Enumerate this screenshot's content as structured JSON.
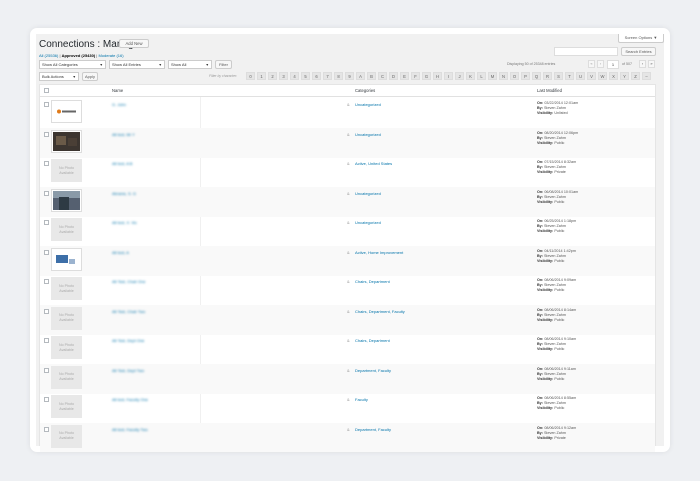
{
  "header": {
    "title": "Connections : Manage",
    "add_new": "Add New",
    "screen_options": "Screen Options ▼"
  },
  "subsubsub": {
    "all": "All (25536)",
    "sep1": " | ",
    "approved": "Approved (25430)",
    "sep2": " | ",
    "moderate": "Moderate (16)"
  },
  "search": {
    "button": "Search Entries"
  },
  "filters": {
    "categories": "Show All Categories",
    "entries": "Show All Entries",
    "show": "Show All",
    "filter_button": "Filter"
  },
  "pagination": {
    "displaying": "Displaying 50 of 25348 entries",
    "first": "«",
    "prev": "‹",
    "current": "1",
    "of": "of 507",
    "next": "›",
    "last": "»"
  },
  "bulk": {
    "label": "Bulk Actions",
    "apply": "Apply"
  },
  "char_filter": {
    "label": "Filter by character:",
    "chars": [
      "0",
      "1",
      "2",
      "3",
      "4",
      "5",
      "6",
      "7",
      "8",
      "9",
      "A",
      "B",
      "C",
      "D",
      "E",
      "F",
      "G",
      "H",
      "I",
      "J",
      "K",
      "L",
      "M",
      "N",
      "O",
      "P",
      "Q",
      "R",
      "S",
      "T",
      "U",
      "V",
      "W",
      "X",
      "Y",
      "Z",
      "–"
    ]
  },
  "table": {
    "headers": {
      "name": "Name",
      "categories": "Categories",
      "modified": "Last Modified"
    },
    "no_photo": "No Photo Available",
    "on_label": "On:",
    "by_label": "By:",
    "vis_label": "Visibility:",
    "rows": [
      {
        "thumb": "logo",
        "name": "G. John",
        "categories": "Uncategorized",
        "on": "03/22/2014 12:01am",
        "by": "Steven Zahm",
        "visibility": "Unlisted"
      },
      {
        "thumb": "dark",
        "name": "Alt test, Mr Y",
        "categories": "Uncategorized",
        "on": "08/20/2014 12:06pm",
        "by": "Steven Zahm",
        "visibility": "Public"
      },
      {
        "thumb": "none",
        "name": "Alt test, A B",
        "categories": "Active, United States",
        "on": "07/15/2014 8:32am",
        "by": "Steven Zahm",
        "visibility": "Private"
      },
      {
        "thumb": "photo",
        "name": "Abrams, S. G",
        "categories": "Uncategorized",
        "on": "06/08/2014 10:01am",
        "by": "Steven Zahm",
        "visibility": "Public"
      },
      {
        "thumb": "none",
        "name": "Alt test, X. Vic",
        "categories": "Uncategorized",
        "on": "06/25/2014 1:18pm",
        "by": "Steven Zahm",
        "visibility": "Public"
      },
      {
        "thumb": "blue",
        "name": "Alt test, A",
        "categories": "Active, Home Improvement",
        "on": "04/11/2014 1:42pm",
        "by": "Steven Zahm",
        "visibility": "Public"
      },
      {
        "thumb": "none",
        "name": "Alt Test, Chair One",
        "categories": "Chairs, Department",
        "on": "08/06/2014 9:09am",
        "by": "Steven Zahm",
        "visibility": "Public"
      },
      {
        "thumb": "none",
        "name": "Alt Test, Chair Two",
        "categories": "Chairs, Department, Faculty",
        "on": "08/06/2014 8:14am",
        "by": "Steven Zahm",
        "visibility": "Public"
      },
      {
        "thumb": "none",
        "name": "Alt Test, Dept One",
        "categories": "Chairs, Department",
        "on": "08/06/2014 9:10am",
        "by": "Steven Zahm",
        "visibility": "Public"
      },
      {
        "thumb": "none",
        "name": "Alt Test, Dept Two",
        "categories": "Department, Faculty",
        "on": "08/06/2014 9:11am",
        "by": "Steven Zahm",
        "visibility": "Public"
      },
      {
        "thumb": "none",
        "name": "Alt test, Faculty One",
        "categories": "Faculty",
        "on": "08/06/2014 8:55am",
        "by": "Steven Zahm",
        "visibility": "Public"
      },
      {
        "thumb": "none",
        "name": "Alt test, Faculty Two",
        "categories": "Department, Faculty",
        "on": "08/06/2014 9:12am",
        "by": "Steven Zahm",
        "visibility": "Private"
      }
    ]
  }
}
